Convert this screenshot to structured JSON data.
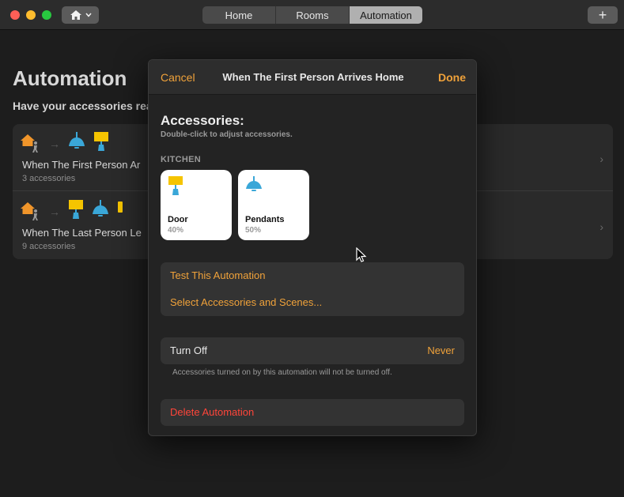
{
  "titlebar": {
    "tabs": [
      {
        "label": "Home",
        "active": false
      },
      {
        "label": "Rooms",
        "active": false
      },
      {
        "label": "Automation",
        "active": true
      }
    ],
    "plus_label": "+"
  },
  "background": {
    "title": "Automation",
    "subtitle": "Have your accessories reac",
    "automations": [
      {
        "name": "When The First Person Ar",
        "count": "3 accessories"
      },
      {
        "name": "When The Last Person Le",
        "count": "9 accessories"
      }
    ]
  },
  "sheet": {
    "cancel": "Cancel",
    "title": "When The First Person Arrives Home",
    "done": "Done",
    "accessories_title": "Accessories:",
    "accessories_hint": "Double-click to adjust accessories.",
    "room": "KITCHEN",
    "tiles": [
      {
        "name": "Door",
        "state": "40%",
        "icon": "wall-lamp-icon"
      },
      {
        "name": "Pendants",
        "state": "50%",
        "icon": "pendant-lamp-icon"
      }
    ],
    "actions": {
      "test": "Test This Automation",
      "select": "Select Accessories and Scenes..."
    },
    "turn_off": {
      "label": "Turn Off",
      "value": "Never",
      "note": "Accessories turned on by this automation will not be turned off."
    },
    "delete": "Delete Automation"
  },
  "colors": {
    "accent": "#f0a23a",
    "destructive": "#ff453a",
    "lamp_yellow": "#f5c400",
    "lamp_blue": "#3aa7d8",
    "home_orange": "#f0952a"
  }
}
